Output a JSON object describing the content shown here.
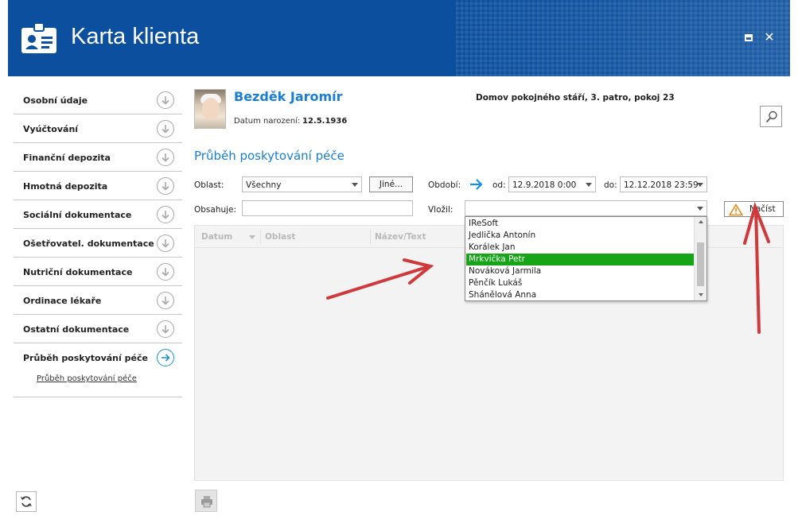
{
  "window": {
    "title": "Karta klienta"
  },
  "sidebar": {
    "items": [
      {
        "label": "Osobní údaje"
      },
      {
        "label": "Vyúčtování"
      },
      {
        "label": "Finanční depozita"
      },
      {
        "label": "Hmotná depozita"
      },
      {
        "label": "Sociální dokumentace"
      },
      {
        "label": "Ošetřovatel. dokumentace"
      },
      {
        "label": "Nutriční dokumentace"
      },
      {
        "label": "Ordinace lékaře"
      },
      {
        "label": "Ostatní dokumentace"
      },
      {
        "label": "Průběh poskytování péče"
      }
    ],
    "sub_link": "Průběh poskytování péče"
  },
  "patient": {
    "name": "Bezděk Jaromír",
    "dob_label": "Datum narození:",
    "dob": "12.5.1936",
    "facility": "Domov pokojného stáří, 3. patro, pokoj 23"
  },
  "section": {
    "title": "Průběh poskytování péče"
  },
  "filters": {
    "area_label": "Oblast:",
    "area_value": "Všechny",
    "other_button": "Jiné...",
    "period_label": "Období:",
    "from_label": "od:",
    "from_value": "12.9.2018 0:00",
    "to_label": "do:",
    "to_value": "12.12.2018 23:59",
    "contains_label": "Obsahuje:",
    "contains_value": "",
    "inserted_label": "Vložil:",
    "inserted_value": "",
    "load_button": "Načíst"
  },
  "grid": {
    "columns": [
      "Datum",
      "Oblast",
      "Název/Text"
    ]
  },
  "dropdown": {
    "options": [
      "IReSoft",
      "Jedlička Antonín",
      "Korálek Jan",
      "Mrkvička Petr",
      "Nováková Jarmila",
      "Pěnčík Lukáš",
      "Shánělová Anna"
    ],
    "selected": "Mrkvička Petr"
  },
  "colors": {
    "titlebar": "#0b4f9e",
    "accent": "#1a7ed4",
    "selection": "#16a516",
    "annotation": "#d0393b"
  }
}
